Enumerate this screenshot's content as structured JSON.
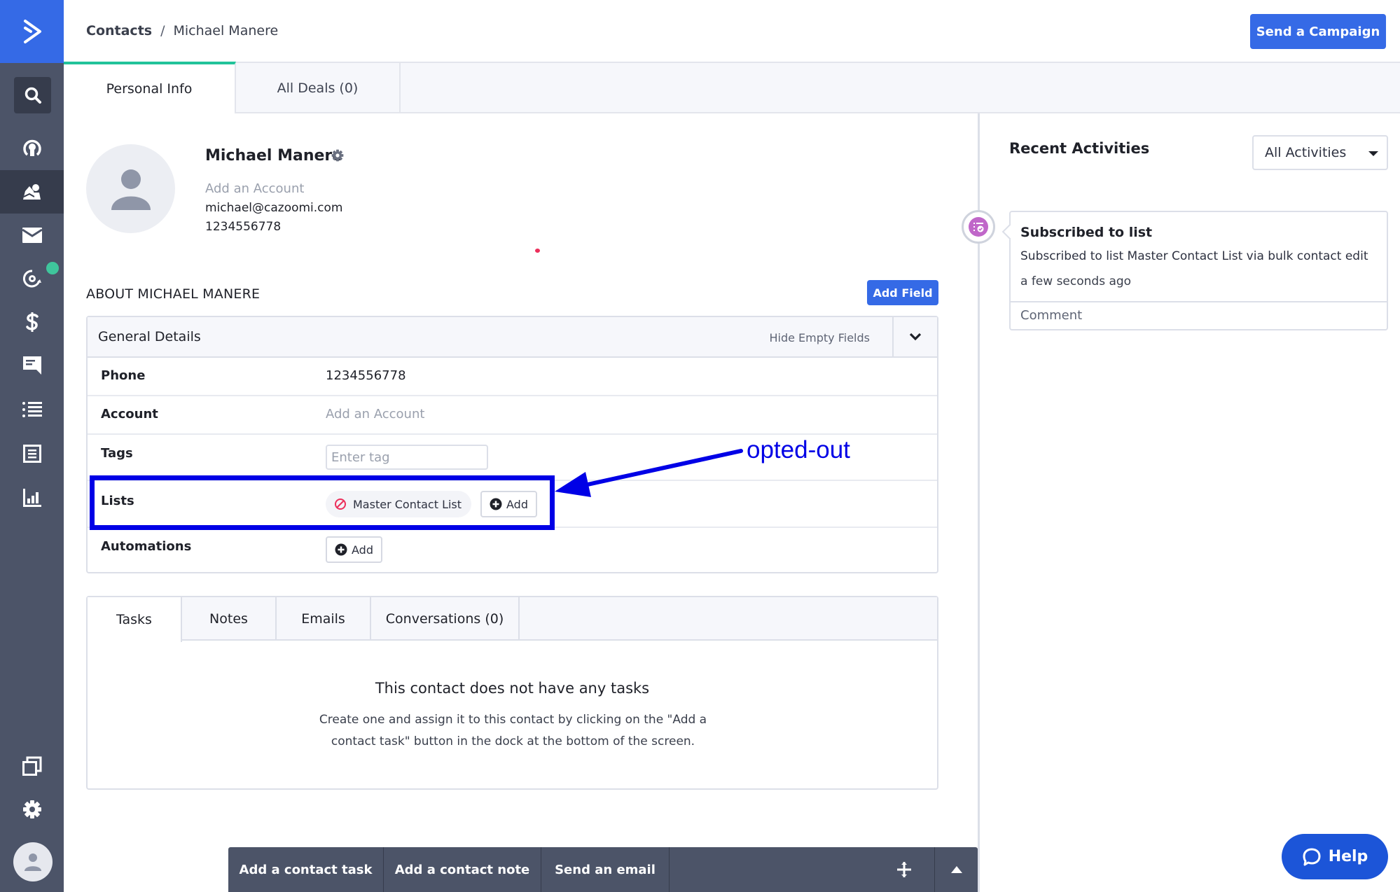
{
  "app": {
    "logo": "activecampaign-logo",
    "brand_color": "#356ae6",
    "sidebar_color": "#4c5468",
    "accent_green": "#22c39a"
  },
  "sidebar": {
    "items": [
      {
        "icon": "search-icon",
        "label": "Search"
      },
      {
        "icon": "target-icon",
        "label": "Dashboard"
      },
      {
        "icon": "contacts-icon",
        "label": "Contacts",
        "active": true
      },
      {
        "icon": "envelope-icon",
        "label": "Campaigns"
      },
      {
        "icon": "automation-icon",
        "label": "Automations",
        "notification": true
      },
      {
        "icon": "dollar-icon",
        "label": "Deals"
      },
      {
        "icon": "chat-icon",
        "label": "Conversations"
      },
      {
        "icon": "list-icon",
        "label": "Lists"
      },
      {
        "icon": "form-icon",
        "label": "Forms"
      },
      {
        "icon": "chart-icon",
        "label": "Reports"
      },
      {
        "icon": "pages-icon",
        "label": "Pages"
      },
      {
        "icon": "gear-icon",
        "label": "Settings"
      },
      {
        "icon": "user-avatar-icon",
        "label": "Profile"
      }
    ]
  },
  "header": {
    "breadcrumb_root": "Contacts",
    "breadcrumb_separator": "/",
    "breadcrumb_current": "Michael Manere",
    "send_campaign_label": "Send a Campaign"
  },
  "tabs": [
    {
      "label": "Personal Info",
      "active": true
    },
    {
      "label": "All Deals (0)",
      "active": false
    }
  ],
  "contact": {
    "name": "Michael Manere",
    "account_placeholder": "Add an Account",
    "email": "michael@cazoomi.com",
    "phone": "1234556778"
  },
  "about": {
    "heading": "ABOUT MICHAEL MANERE",
    "add_field_label": "Add Field",
    "panel_title": "General Details",
    "hide_empty_label": "Hide Empty Fields",
    "fields": {
      "phone": {
        "label": "Phone",
        "value": "1234556778"
      },
      "account": {
        "label": "Account",
        "value": "Add an Account"
      },
      "tags": {
        "label": "Tags",
        "placeholder": "Enter tag"
      },
      "lists": {
        "label": "Lists",
        "chip": "Master Contact List",
        "chip_status": "opted-out",
        "add_label": "Add"
      },
      "automations": {
        "label": "Automations",
        "add_label": "Add"
      }
    }
  },
  "lower_tabs": {
    "tabs": [
      {
        "label": "Tasks",
        "active": true
      },
      {
        "label": "Notes"
      },
      {
        "label": "Emails"
      },
      {
        "label": "Conversations (0)"
      }
    ],
    "empty_title": "This contact does not have any tasks",
    "empty_desc": "Create one and assign it to this contact by clicking on the \"Add a contact task\" button in the dock at the bottom of the screen."
  },
  "dock": {
    "items": [
      "Add a contact task",
      "Add a contact note",
      "Send an email"
    ]
  },
  "activities": {
    "title": "Recent Activities",
    "filter_selected": "All Activities",
    "items": [
      {
        "icon": "list-subscribed-icon",
        "title": "Subscribed to list",
        "description": "Subscribed to list Master Contact List via bulk contact edit",
        "time": "a few seconds ago",
        "comment_placeholder": "Comment"
      }
    ]
  },
  "help": {
    "label": "Help"
  },
  "annotation": {
    "text": "opted-out",
    "color": "#0000e6"
  }
}
